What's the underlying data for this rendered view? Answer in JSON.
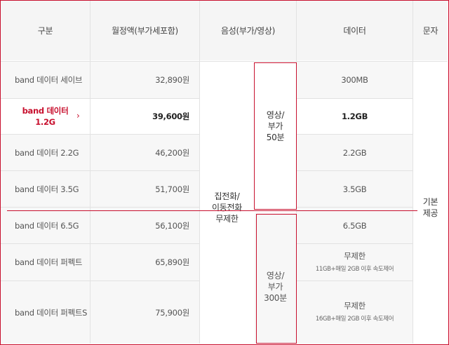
{
  "headers": {
    "category": "구분",
    "monthly_fee": "월정액(부가세포함)",
    "voice": "음성(부가/영상)",
    "data": "데이터",
    "sms": "문자"
  },
  "plans": [
    {
      "name": "band 데이터 세이브",
      "price": "32,890원",
      "data": "300MB"
    },
    {
      "name": "band 데이터 1.2G",
      "price": "39,600원",
      "data": "1.2GB"
    },
    {
      "name": "band 데이터 2.2G",
      "price": "46,200원",
      "data": "2.2GB"
    },
    {
      "name": "band 데이터 3.5G",
      "price": "51,700원",
      "data": "3.5GB"
    },
    {
      "name": "band 데이터 6.5G",
      "price": "56,100원",
      "data": "6.5GB"
    },
    {
      "name": "band 데이터 퍼펙트",
      "price": "65,890원",
      "data": "무제한",
      "data_note": "11GB+매일 2GB 이후 속도제어"
    },
    {
      "name": "band 데이터 퍼펙트S",
      "price": "75,900원",
      "data": "무제한",
      "data_note": "16GB+매일 2GB 이후 속도제어"
    }
  ],
  "highlighted_name": {
    "line1": "band 데이터",
    "line2": "1.2G",
    "chevron": "›"
  },
  "voice_call": {
    "line1": "집전화/",
    "line2": "이동전화",
    "line3": "무제한"
  },
  "video_upper": {
    "line1": "영상/",
    "line2": "부가",
    "line3": "50분"
  },
  "video_lower": {
    "line1": "영상/",
    "line2": "부가",
    "line3": "300분"
  },
  "sms": {
    "line1": "기본",
    "line2": "제공"
  },
  "accent_color": "#c8102e"
}
